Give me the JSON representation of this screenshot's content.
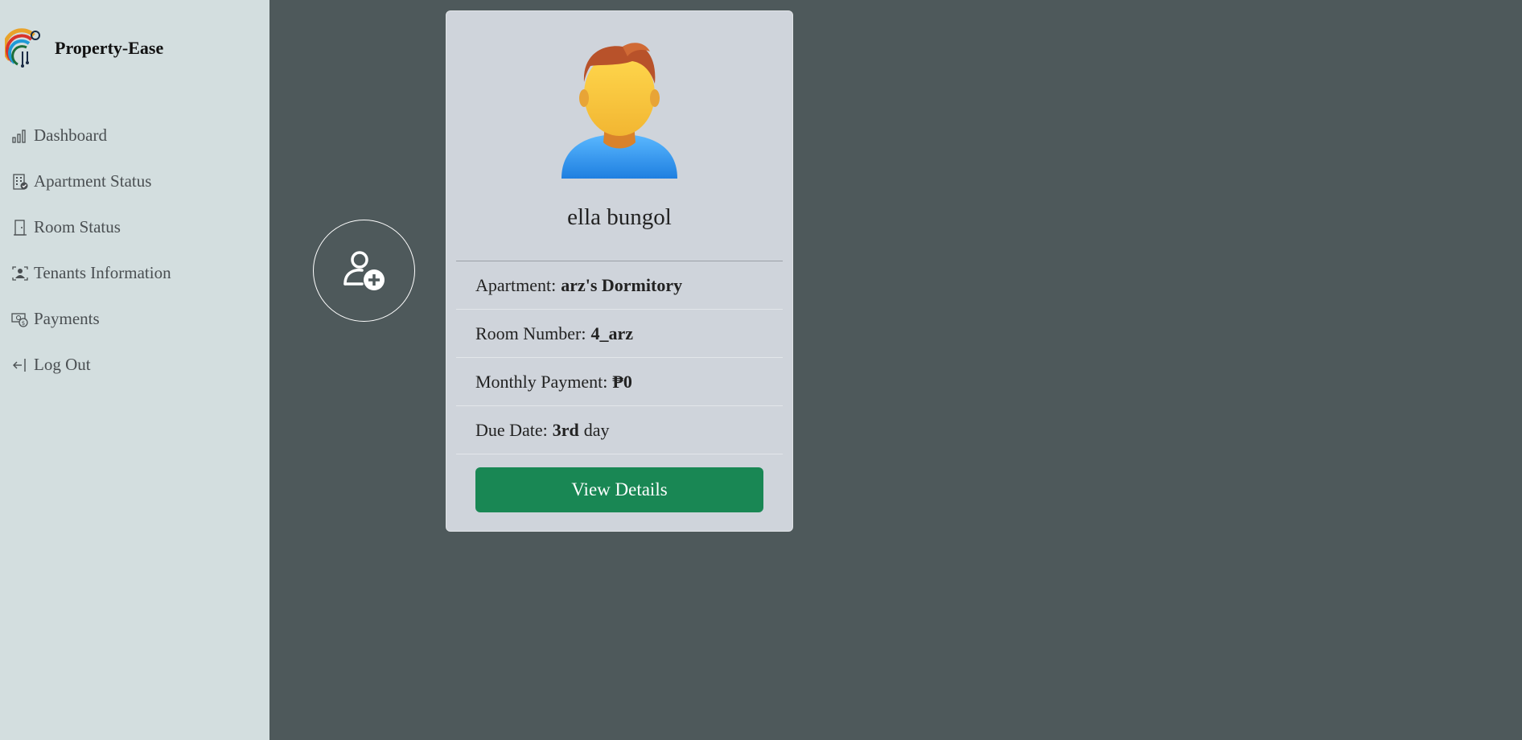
{
  "brand": {
    "name": "Property-Ease",
    "logo_icon": "property-ease-logo"
  },
  "sidebar": {
    "items": [
      {
        "label": "Dashboard",
        "icon": "bar-chart-icon"
      },
      {
        "label": "Apartment Status",
        "icon": "building-check-icon"
      },
      {
        "label": "Room Status",
        "icon": "door-icon"
      },
      {
        "label": "Tenants Information",
        "icon": "person-badge-icon"
      },
      {
        "label": "Payments",
        "icon": "cash-coin-icon"
      },
      {
        "label": "Log Out",
        "icon": "logout-arrow-icon"
      }
    ]
  },
  "add_tenant": {
    "icon": "person-add-icon"
  },
  "tenant_card": {
    "name": "ella bungol",
    "avatar_icon": "user-avatar-icon",
    "apartment_label": "Apartment:",
    "apartment_value": "arz's Dormitory",
    "room_label": "Room Number:",
    "room_value": "4_arz",
    "payment_label": "Monthly Payment:",
    "payment_value": "₱0",
    "due_label": "Due Date:",
    "due_value": "3rd",
    "due_suffix": "day",
    "button_label": "View Details"
  },
  "colors": {
    "sidebar_bg": "#d3dedf",
    "main_bg": "#4e595b",
    "card_bg": "#cfd4db",
    "button_bg": "#198754"
  }
}
